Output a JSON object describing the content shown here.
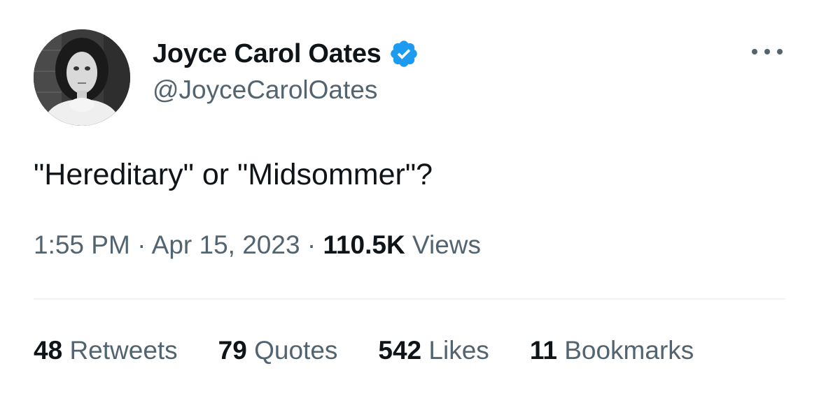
{
  "author": {
    "display_name": "Joyce Carol Oates",
    "handle": "@JoyceCarolOates",
    "verified": true,
    "avatar_icon": "profile-photo",
    "verified_icon": "verified-badge-icon"
  },
  "tweet": {
    "text": "\"Hereditary\" or \"Midsommer\"?",
    "time": "1:55 PM",
    "separator": "·",
    "date": "Apr 15, 2023",
    "views_count": "110.5K",
    "views_label": "Views"
  },
  "stats": [
    {
      "count": "48",
      "label": "Retweets"
    },
    {
      "count": "79",
      "label": "Quotes"
    },
    {
      "count": "542",
      "label": "Likes"
    },
    {
      "count": "11",
      "label": "Bookmarks"
    }
  ],
  "colors": {
    "primary_text": "#0f1419",
    "secondary_text": "#536471",
    "verified_blue": "#1d9bf0",
    "divider": "#eff3f4"
  }
}
